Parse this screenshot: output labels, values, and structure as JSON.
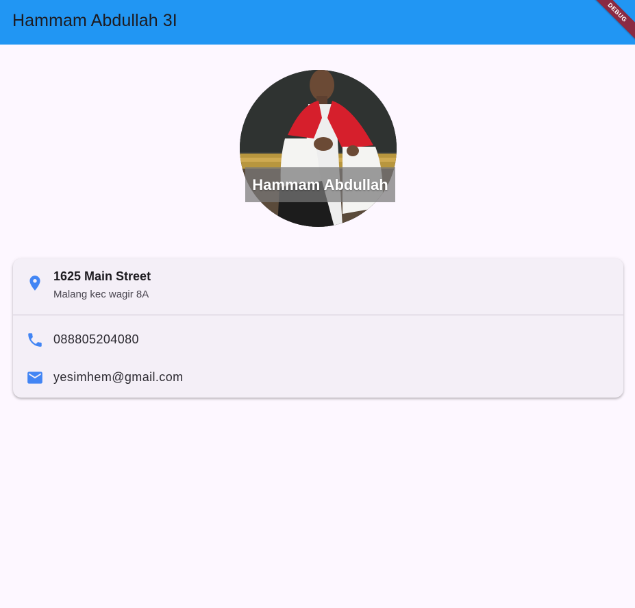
{
  "appbar": {
    "title": "Hammam Abdullah 3I",
    "color": "#2196f3"
  },
  "debug_banner": {
    "label": "DEBUG"
  },
  "profile": {
    "name": "Hammam Abdullah"
  },
  "contact_card": {
    "address": {
      "icon": "location-pin-icon",
      "street": "1625 Main Street",
      "detail": "Malang kec wagir 8A"
    },
    "phone": {
      "icon": "phone-icon",
      "number": "088805204080"
    },
    "email": {
      "icon": "mail-icon",
      "address": "yesimhem@gmail.com"
    },
    "accent_color": "#4285f4"
  }
}
